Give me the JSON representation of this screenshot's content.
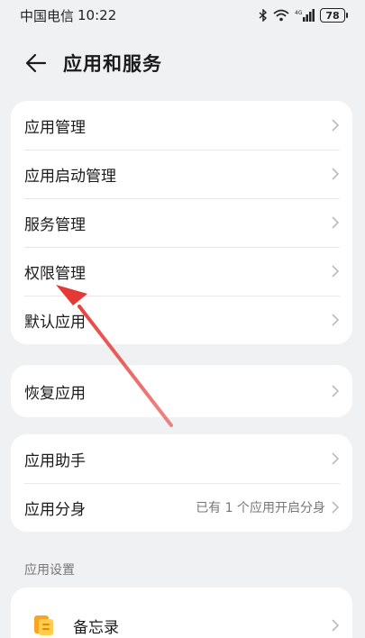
{
  "status": {
    "carrier": "中国电信",
    "time": "10:22",
    "network": "4G",
    "battery": "78"
  },
  "header": {
    "title": "应用和服务"
  },
  "card1": {
    "items": [
      {
        "label": "应用管理"
      },
      {
        "label": "应用启动管理"
      },
      {
        "label": "服务管理"
      },
      {
        "label": "权限管理"
      },
      {
        "label": "默认应用"
      }
    ]
  },
  "card2": {
    "items": [
      {
        "label": "恢复应用"
      }
    ]
  },
  "card3": {
    "items": [
      {
        "label": "应用助手"
      },
      {
        "label": "应用分身",
        "value": "已有 1 个应用开启分身"
      }
    ]
  },
  "settings": {
    "section_title": "应用设置",
    "items": [
      {
        "label": "备忘录",
        "icon": "memo-app-icon"
      }
    ]
  },
  "annotation": {
    "arrow_color": "#e53935"
  }
}
